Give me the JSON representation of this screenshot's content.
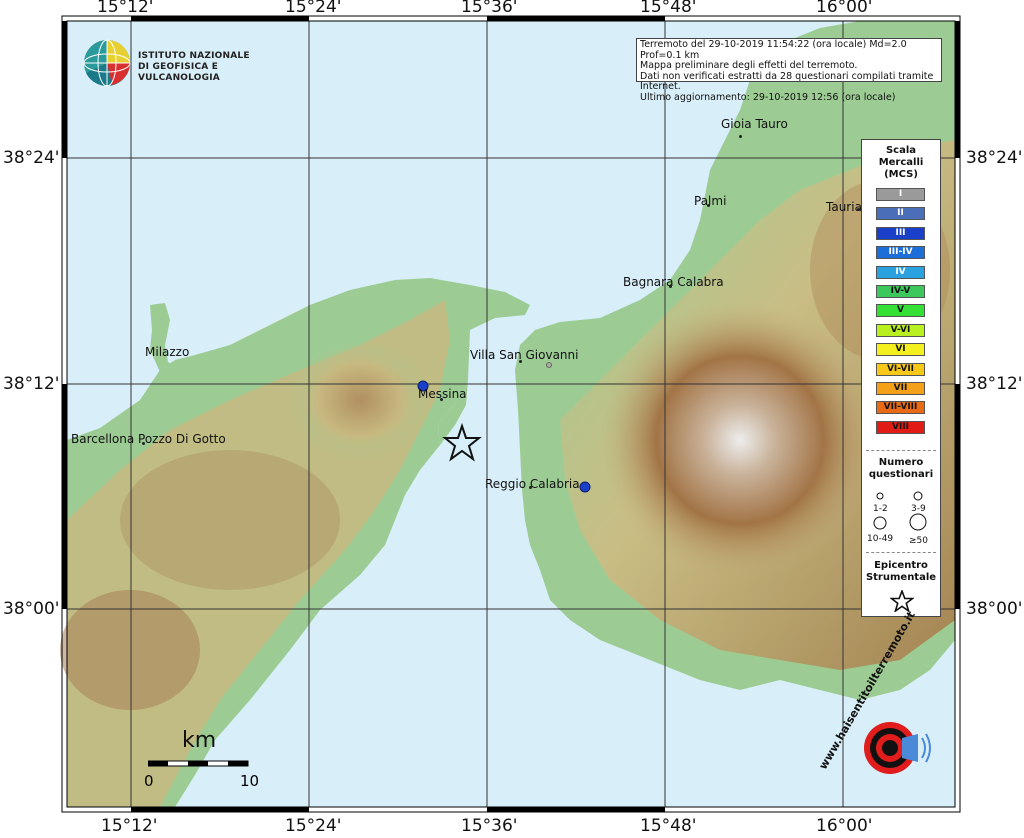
{
  "coordinates": {
    "top_longitudes": [
      "15°12'",
      "15°24'",
      "15°36'",
      "15°48'",
      "16°00'"
    ],
    "bottom_longitudes": [
      "15°12'",
      "15°24'",
      "15°36'",
      "15°48'",
      "16°00'"
    ],
    "left_latitudes": [
      "38°24'",
      "38°12'",
      "38°00'"
    ],
    "right_latitudes": [
      "38°24'",
      "38°12'",
      "38°00'"
    ]
  },
  "logo": {
    "line1": "ISTITUTO NAZIONALE",
    "line2": "DI GEOFISICA E VULCANOLOGIA"
  },
  "info_box": {
    "line1": "Terremoto del 29-10-2019 11:54:22 (ora locale) Md=2.0 Prof=0.1 km",
    "line2": "Mappa preliminare degli effetti del terremoto.",
    "line3": "Dati non verificati estratti da 28 questionari compilati tramite Internet.",
    "line4": "Ultimo aggiornamento: 29-10-2019 12:56 (ora locale)"
  },
  "places": [
    {
      "name": "Gioia Tauro"
    },
    {
      "name": "Palmi"
    },
    {
      "name": "Tauria"
    },
    {
      "name": "Bagnara Calabra"
    },
    {
      "name": "Villa San Giovanni"
    },
    {
      "name": "Milazzo"
    },
    {
      "name": "Messina"
    },
    {
      "name": "Barcellona Pozzo Di Gotto"
    },
    {
      "name": "Reggio Calabria"
    }
  ],
  "legend": {
    "title_line1": "Scala",
    "title_line2": "Mercalli",
    "title_line3": "(MCS)",
    "classes": [
      {
        "label": "I",
        "color": "#9a9a9a",
        "text": "#ffffff"
      },
      {
        "label": "II",
        "color": "#4a6fb8",
        "text": "#ffffff"
      },
      {
        "label": "III",
        "color": "#1a3fc8",
        "text": "#ffffff"
      },
      {
        "label": "III-IV",
        "color": "#1c6fd8",
        "text": "#ffffff"
      },
      {
        "label": "IV",
        "color": "#2aa2e0",
        "text": "#ffffff"
      },
      {
        "label": "IV-V",
        "color": "#3cc85c",
        "text": "#111111"
      },
      {
        "label": "V",
        "color": "#33e033",
        "text": "#111111"
      },
      {
        "label": "V-VI",
        "color": "#b8f020",
        "text": "#111111"
      },
      {
        "label": "VI",
        "color": "#f4f020",
        "text": "#111111"
      },
      {
        "label": "VI-VII",
        "color": "#f8c818",
        "text": "#111111"
      },
      {
        "label": "VII",
        "color": "#f4a018",
        "text": "#111111"
      },
      {
        "label": "VII-VIII",
        "color": "#e86a14",
        "text": "#111111"
      },
      {
        "label": "VIII",
        "color": "#e01c14",
        "text": "#111111"
      }
    ],
    "questionnaires_title_line1": "Numero",
    "questionnaires_title_line2": "questionari",
    "q_sizes": [
      "1-2",
      "3-9",
      "10-49",
      "≥50"
    ],
    "epicenter_title_line1": "Epicentro",
    "epicenter_title_line2": "Strumentale"
  },
  "scalebar": {
    "unit": "km",
    "start": "0",
    "end": "10"
  },
  "intensity_points": [
    {
      "place": "Messina",
      "intensity": "III"
    },
    {
      "place": "Reggio Calabria",
      "intensity": "III"
    }
  ],
  "watermark": {
    "text": "www.haisentitoilterremoto.it"
  },
  "colors": {
    "sea": "#d8eef8",
    "lowland": "#90c890",
    "hills": "#c8b880",
    "mountains": "#9a7048",
    "peaks": "#e8e8e8",
    "grid": "#333333",
    "frame": "#000000"
  }
}
